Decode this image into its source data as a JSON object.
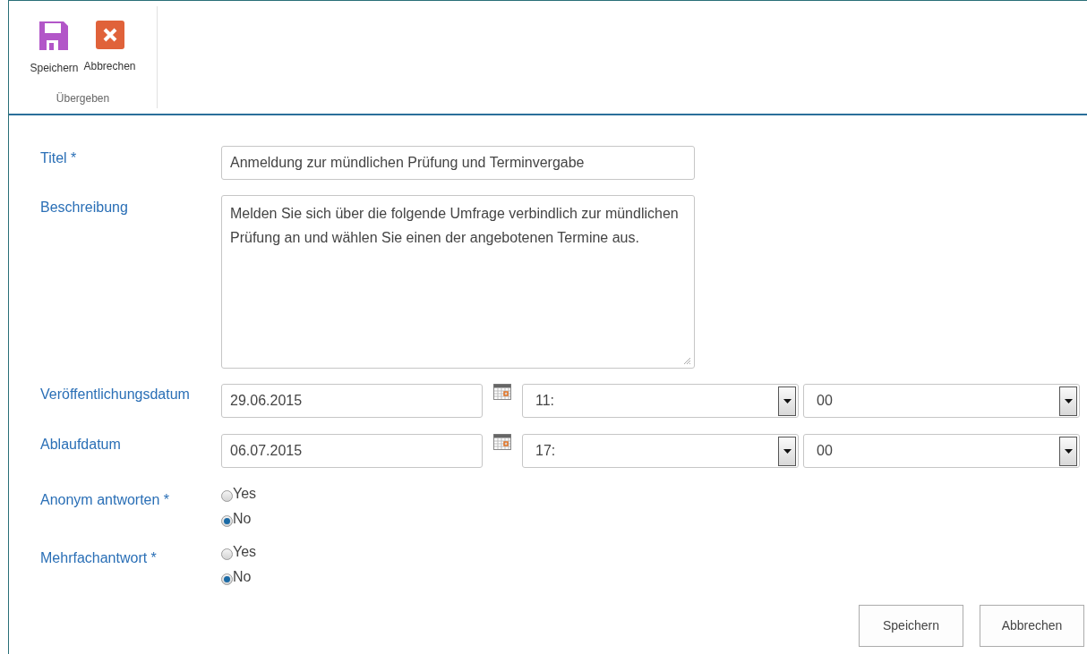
{
  "ribbon": {
    "buttons": [
      {
        "label": "Speichern",
        "kind": "save"
      },
      {
        "label": "Abbrechen",
        "kind": "cancel"
      }
    ],
    "group_label": "Übergeben"
  },
  "form": {
    "fields": [
      {
        "kind": "text",
        "label": "Titel *",
        "value": "Anmeldung zur mündlichen Prüfung und Terminvergabe"
      },
      {
        "kind": "textarea",
        "label": "Beschreibung",
        "value": "Melden Sie sich über die folgende Umfrage verbindlich zur mündlichen Prüfung an und wählen Sie einen der angebotenen Termine aus."
      },
      {
        "kind": "datetime",
        "label": "Veröffentlichungsdatum",
        "date": "29.06.2015",
        "hour": "11:",
        "minute": "00"
      },
      {
        "kind": "datetime",
        "label": "Ablaufdatum",
        "date": "06.07.2015",
        "hour": "17:",
        "minute": "00"
      },
      {
        "kind": "radio",
        "label": "Anonym antworten *",
        "options": [
          {
            "label": "Yes",
            "selected": false
          },
          {
            "label": "No",
            "selected": true
          }
        ]
      },
      {
        "kind": "radio",
        "label": "Mehrfachantwort *",
        "options": [
          {
            "label": "Yes",
            "selected": false
          },
          {
            "label": "No",
            "selected": true
          }
        ]
      }
    ]
  },
  "buttons": [
    "Speichern",
    "Abbrechen"
  ]
}
